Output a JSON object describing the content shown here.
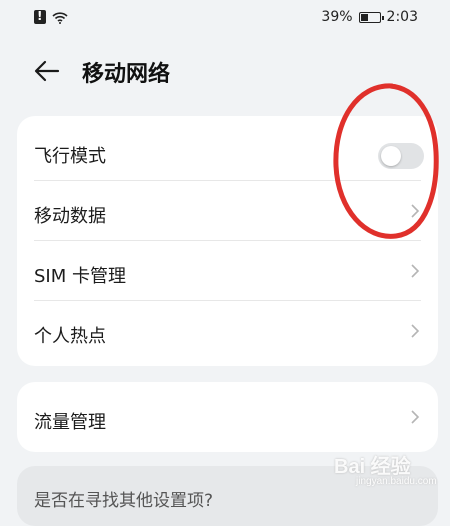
{
  "status_bar": {
    "battery_percent": "39%",
    "time": "2:03",
    "icons": [
      "sim-alert-icon",
      "wifi-icon",
      "battery-icon"
    ]
  },
  "header": {
    "title": "移动网络",
    "back_icon": "arrow-left-icon"
  },
  "settings_group_1": [
    {
      "label": "飞行模式",
      "control": "toggle",
      "checked": false
    },
    {
      "label": "移动数据",
      "control": "chevron"
    },
    {
      "label": "SIM 卡管理",
      "control": "chevron"
    },
    {
      "label": "个人热点",
      "control": "chevron"
    }
  ],
  "settings_group_2": [
    {
      "label": "流量管理",
      "control": "chevron"
    }
  ],
  "suggestion_card": {
    "label": "是否在寻找其他设置项?"
  },
  "annotation": {
    "shape": "ellipse",
    "color": "#e0302b"
  },
  "watermark": {
    "text": "Bai 经验",
    "sub": "jingyan.baidu.com"
  },
  "colors": {
    "background": "#f1f3f5",
    "card": "#ffffff",
    "toggle_off": "#e1e3e5",
    "annotation_red": "#e0302b"
  }
}
